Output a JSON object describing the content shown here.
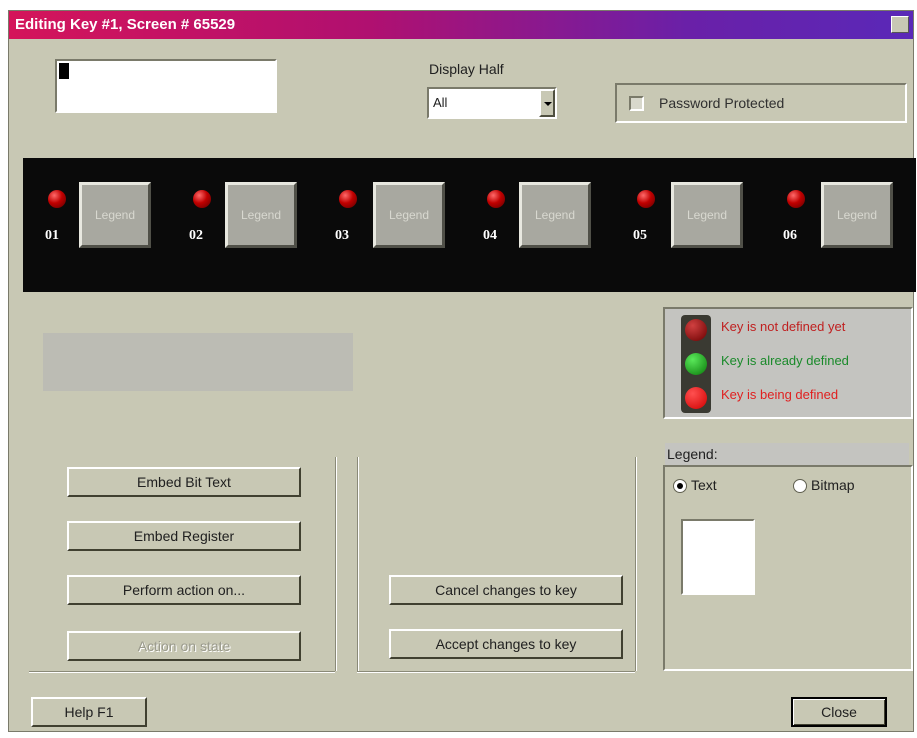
{
  "window": {
    "title": "Editing Key #1, Screen # 65529"
  },
  "display_half": {
    "label": "Display Half",
    "value": "All"
  },
  "password": {
    "label": "Password Protected",
    "checked": false
  },
  "keys": [
    {
      "number": "01",
      "legend": "Legend"
    },
    {
      "number": "02",
      "legend": "Legend"
    },
    {
      "number": "03",
      "legend": "Legend"
    },
    {
      "number": "04",
      "legend": "Legend"
    },
    {
      "number": "05",
      "legend": "Legend"
    },
    {
      "number": "06",
      "legend": "Legend"
    }
  ],
  "status_legend": {
    "items": [
      {
        "text": "Key is not defined yet",
        "color": "#c02020",
        "light": "dark-red"
      },
      {
        "text": "Key is already defined",
        "color": "#1a8a2a",
        "light": "green"
      },
      {
        "text": "Key is being defined",
        "color": "#e02020",
        "light": "bright-red"
      }
    ]
  },
  "buttons": {
    "embed_bit_text": "Embed Bit Text",
    "embed_register": "Embed Register",
    "perform_action": "Perform action on...",
    "action_disabled": "Action on state",
    "cancel": "Cancel changes to key",
    "accept": "Accept changes to key",
    "help": "Help F1",
    "close": "Close"
  },
  "legend_group": {
    "label": "Legend:",
    "text_option": "Text",
    "bitmap_option": "Bitmap",
    "selected": "Text"
  },
  "colors": {
    "title_start": "#d4145a",
    "title_end": "#5a28b8",
    "face": "#c8c8b4"
  }
}
